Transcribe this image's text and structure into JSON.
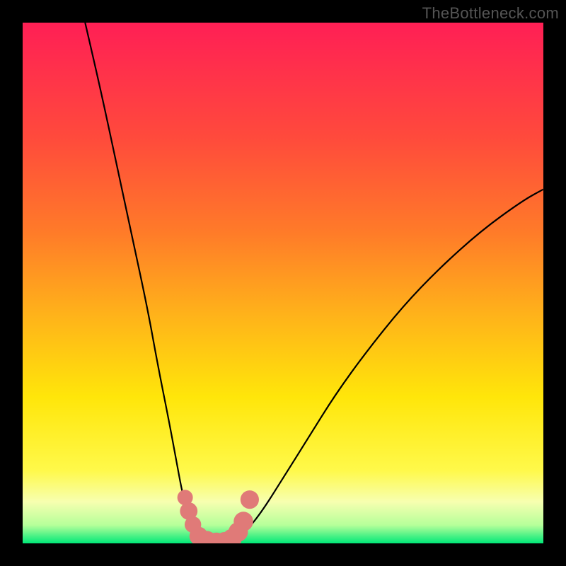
{
  "watermark": "TheBottleneck.com",
  "colors": {
    "frame": "#000000",
    "curve_stroke": "#000000",
    "marker_fill": "#e07a78",
    "marker_stroke": "#b85a58",
    "gradient_stops": [
      "#ff1f55",
      "#ff4a3c",
      "#ff7a29",
      "#ffb21a",
      "#ffe60a",
      "#fff94a",
      "#f7ffb0",
      "#b6ff9a",
      "#00e878"
    ]
  },
  "chart_data": {
    "type": "line",
    "title": "",
    "xlabel": "",
    "ylabel": "",
    "xlim": [
      0,
      100
    ],
    "ylim": [
      0,
      100
    ],
    "gradient_direction": "vertical",
    "curves": [
      {
        "name": "left-branch",
        "x": [
          12,
          15,
          18,
          21,
          24,
          26,
          28,
          29.5,
          30.5,
          31.5,
          32.2,
          33,
          33.8
        ],
        "y": [
          100,
          87,
          73,
          59,
          45,
          34,
          24,
          16,
          10.5,
          6.5,
          3.5,
          1.6,
          0.4
        ]
      },
      {
        "name": "valley",
        "x": [
          33.8,
          35,
          36.5,
          38,
          39.5,
          41
        ],
        "y": [
          0.4,
          0.0,
          0.0,
          0.0,
          0.1,
          0.6
        ]
      },
      {
        "name": "right-branch",
        "x": [
          41,
          43,
          46,
          50,
          55,
          60,
          66,
          73,
          80,
          88,
          96,
          100
        ],
        "y": [
          0.6,
          2.4,
          6.2,
          12.5,
          20.5,
          28.5,
          36.8,
          45.5,
          52.8,
          60.0,
          65.8,
          68.0
        ]
      }
    ],
    "markers": [
      {
        "x": 31.2,
        "y": 8.8,
        "r": 1.0
      },
      {
        "x": 31.9,
        "y": 6.2,
        "r": 1.2
      },
      {
        "x": 32.7,
        "y": 3.6,
        "r": 1.1
      },
      {
        "x": 33.8,
        "y": 1.4,
        "r": 1.3
      },
      {
        "x": 35.4,
        "y": 0.5,
        "r": 1.4
      },
      {
        "x": 37.2,
        "y": 0.2,
        "r": 1.4
      },
      {
        "x": 38.8,
        "y": 0.3,
        "r": 1.4
      },
      {
        "x": 40.2,
        "y": 0.9,
        "r": 1.4
      },
      {
        "x": 41.4,
        "y": 2.2,
        "r": 1.4
      },
      {
        "x": 42.4,
        "y": 4.2,
        "r": 1.4
      },
      {
        "x": 43.6,
        "y": 8.4,
        "r": 1.3
      }
    ]
  }
}
